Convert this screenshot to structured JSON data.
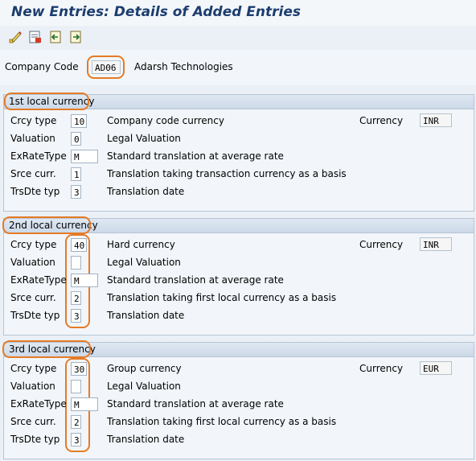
{
  "window": {
    "title": "New Entries: Details of Added Entries"
  },
  "toolbar": {
    "buttons": [
      {
        "icon": "display-change-icon"
      },
      {
        "icon": "delete-icon"
      },
      {
        "icon": "previous-entry-icon"
      },
      {
        "icon": "next-entry-icon"
      }
    ]
  },
  "header": {
    "company_code_label": "Company Code",
    "company_code_value": "AD06",
    "company_name": "Adarsh Technologies"
  },
  "groups": [
    {
      "title": "1st local currency",
      "crcy_type_label": "Crcy type",
      "crcy_type_value": "10",
      "crcy_type_desc": "Company code currency",
      "valuation_label": "Valuation",
      "valuation_value": "0",
      "valuation_desc": "Legal Valuation",
      "exrate_label": "ExRateType",
      "exrate_value": "M",
      "exrate_desc": "Standard translation at average rate",
      "srce_label": "Srce curr.",
      "srce_value": "1",
      "srce_desc": "Translation taking transaction currency as a basis",
      "trsdte_label": "TrsDte typ",
      "trsdte_value": "3",
      "trsdte_desc": "Translation date",
      "currency_label": "Currency",
      "currency_value": "INR"
    },
    {
      "title": "2nd local currency",
      "crcy_type_label": "Crcy type",
      "crcy_type_value": "40",
      "crcy_type_desc": "Hard currency",
      "valuation_label": "Valuation",
      "valuation_value": "",
      "valuation_desc": "Legal Valuation",
      "exrate_label": "ExRateType",
      "exrate_value": "M",
      "exrate_desc": "Standard translation at average rate",
      "srce_label": "Srce curr.",
      "srce_value": "2",
      "srce_desc": "Translation taking first local currency as a basis",
      "trsdte_label": "TrsDte typ",
      "trsdte_value": "3",
      "trsdte_desc": "Translation date",
      "currency_label": "Currency",
      "currency_value": "INR"
    },
    {
      "title": "3rd local currency",
      "crcy_type_label": "Crcy type",
      "crcy_type_value": "30",
      "crcy_type_desc": "Group currency",
      "valuation_label": "Valuation",
      "valuation_value": "",
      "valuation_desc": "Legal Valuation",
      "exrate_label": "ExRateType",
      "exrate_value": "M",
      "exrate_desc": "Standard translation at average rate",
      "srce_label": "Srce curr.",
      "srce_value": "2",
      "srce_desc": "Translation taking first local currency as a basis",
      "trsdte_label": "TrsDte typ",
      "trsdte_value": "3",
      "trsdte_desc": "Translation date",
      "currency_label": "Currency",
      "currency_value": "EUR"
    }
  ],
  "colors": {
    "highlight": "#e57b26",
    "title": "#1c3d6e",
    "background": "#eaf0f6"
  }
}
